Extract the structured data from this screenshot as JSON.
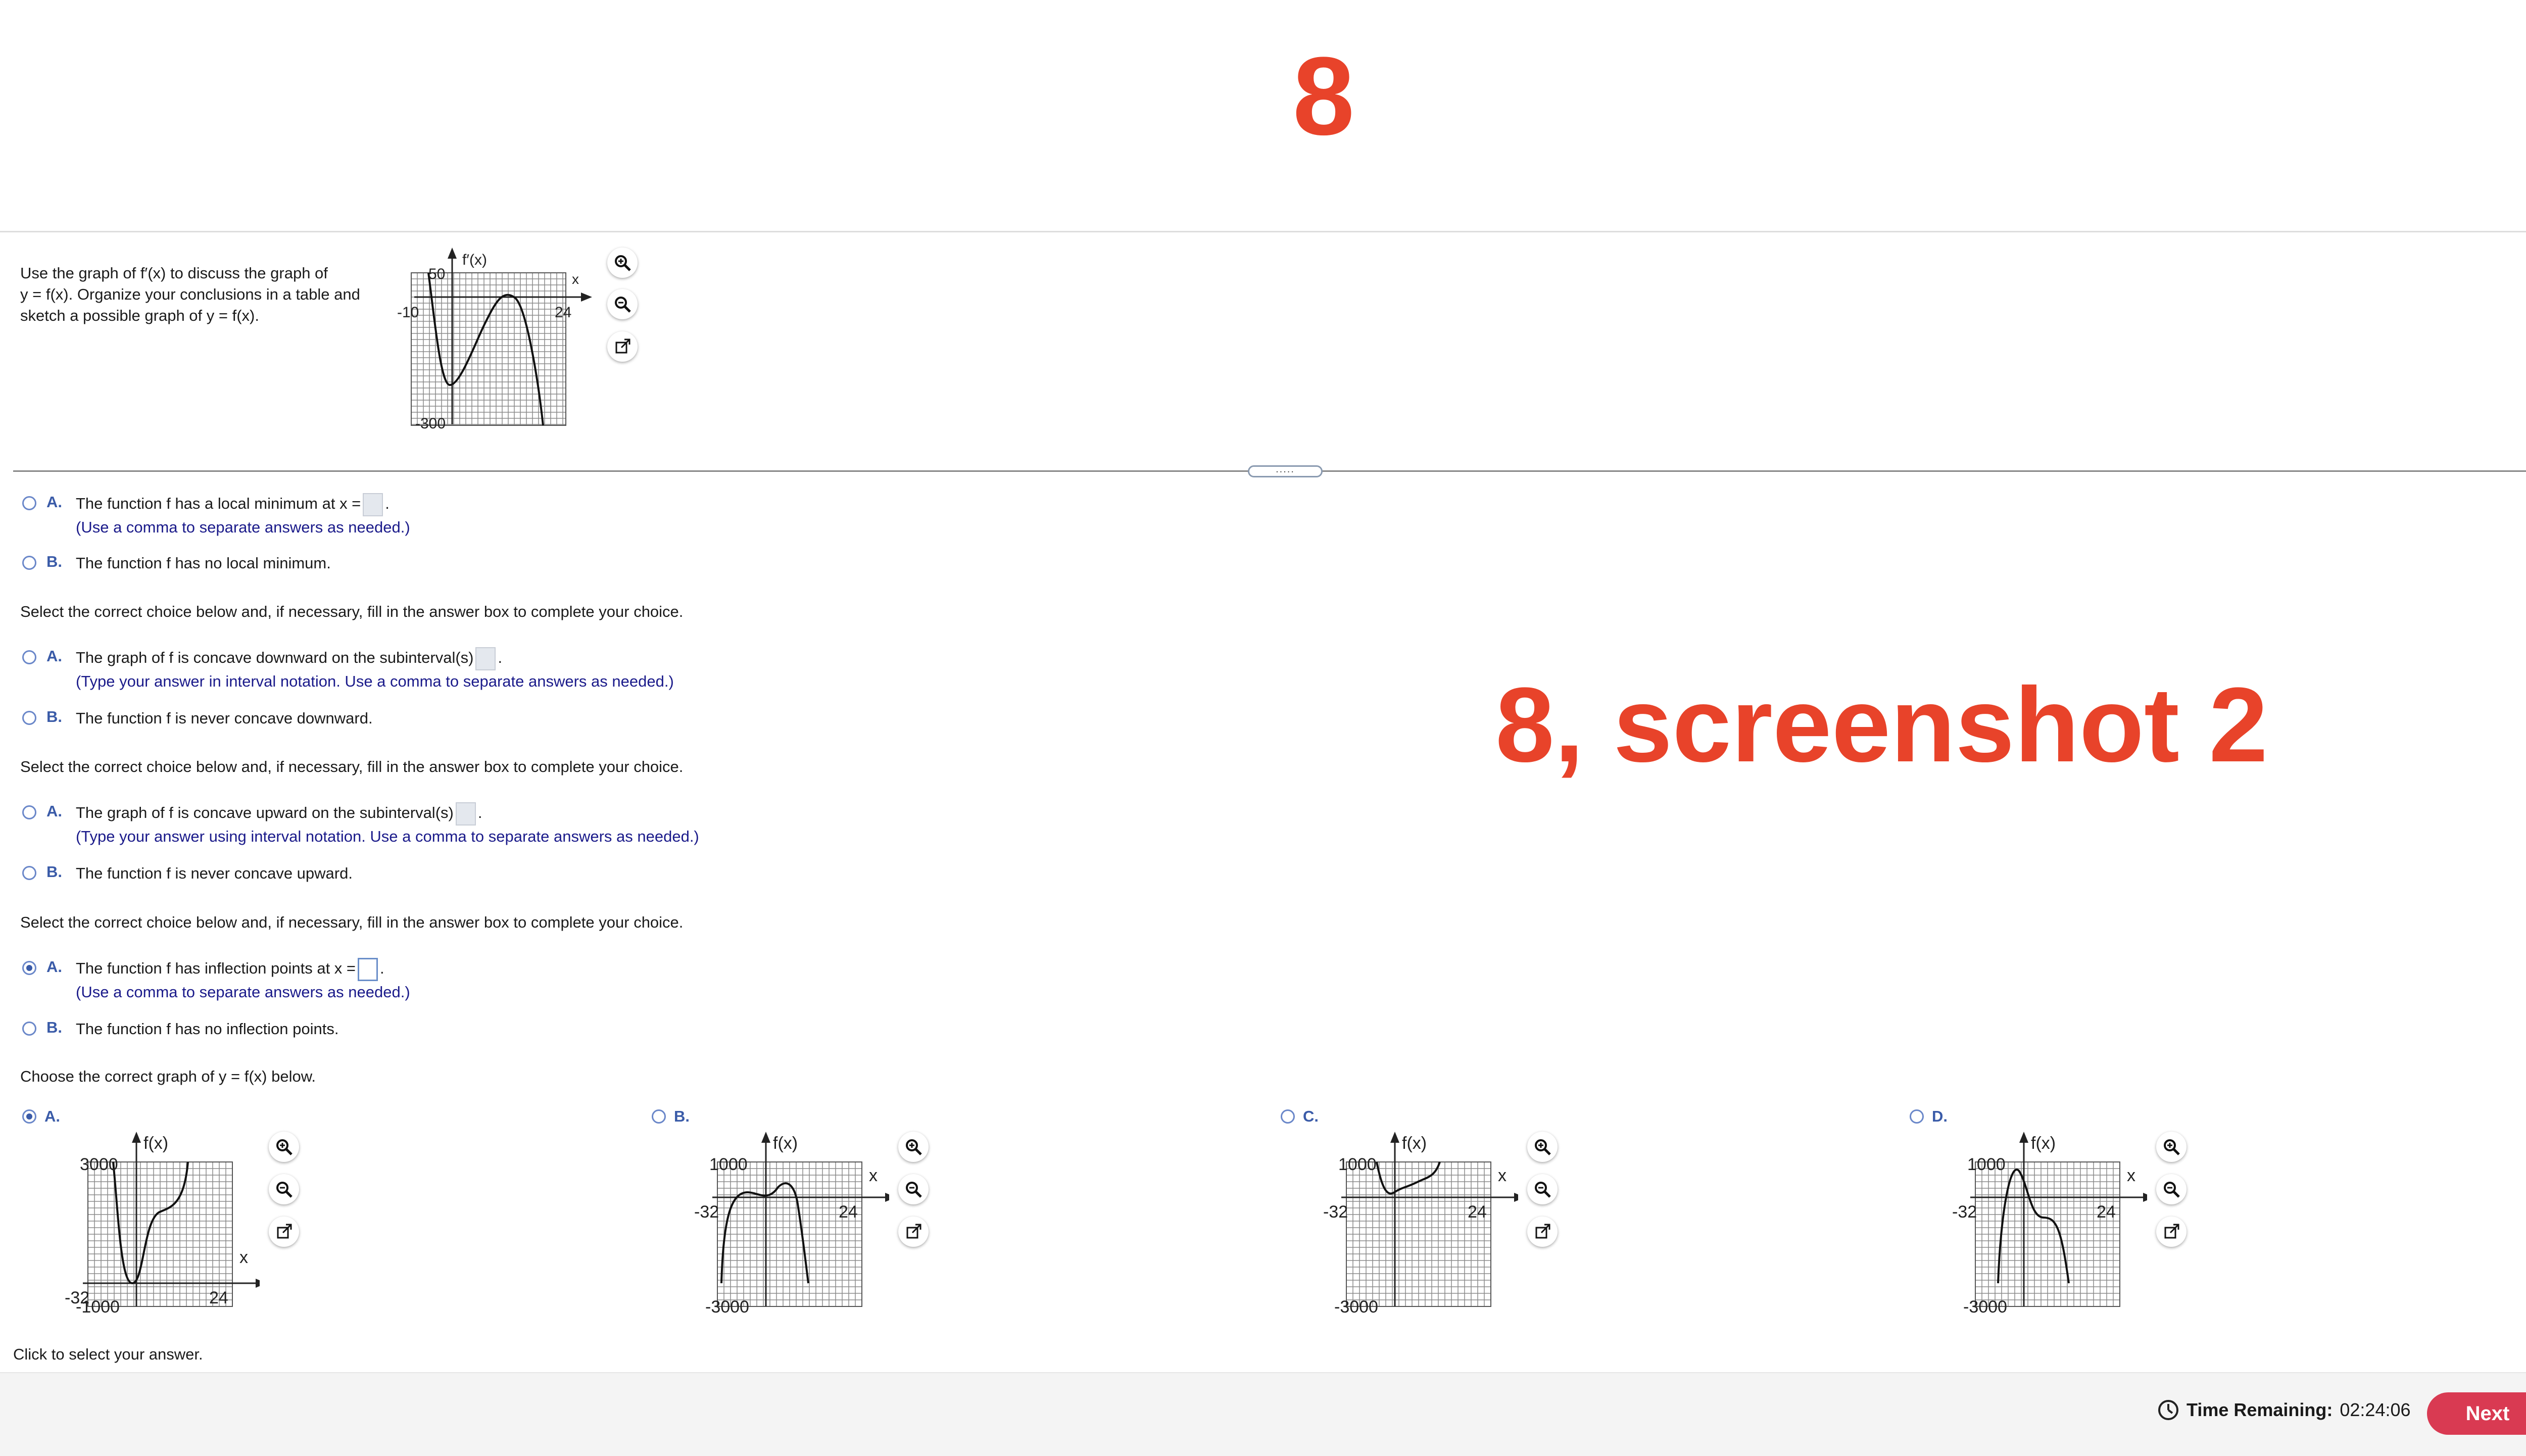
{
  "banner": {
    "number": "8",
    "caption": "8, screenshot 2"
  },
  "question": {
    "prompt": [
      "Use the graph of f′(x) to discuss the graph of",
      "y = f(x). Organize your conclusions in a table and",
      "sketch a possible graph of y = f(x)."
    ],
    "graph": {
      "ylabel": "f′(x)",
      "xlabel": "x",
      "xmin_label": "-10",
      "xmax_label": "24",
      "ymax_label": "50",
      "ymin_label": "-300"
    }
  },
  "splitter": {
    "label": "....."
  },
  "parts": [
    {
      "instruction": "",
      "options": [
        {
          "letter": "A.",
          "text": "The function f has a local minimum at x =",
          "hint": "(Use a comma to separate answers as needed.)",
          "selected": false,
          "has_box": true
        },
        {
          "letter": "B.",
          "text": "The function f has no local minimum.",
          "selected": false
        }
      ]
    },
    {
      "instruction": "Select the correct choice below and, if necessary, fill in the answer box to complete your choice.",
      "options": [
        {
          "letter": "A.",
          "text": "The graph of f is concave downward on the subinterval(s)",
          "hint": "(Type your answer in interval notation. Use a comma to separate answers as needed.)",
          "selected": false,
          "has_box": true
        },
        {
          "letter": "B.",
          "text": "The function f is never concave downward.",
          "selected": false
        }
      ]
    },
    {
      "instruction": "Select the correct choice below and, if necessary, fill in the answer box to complete your choice.",
      "options": [
        {
          "letter": "A.",
          "text": "The graph of f is concave upward on the subinterval(s)",
          "hint": "(Type your answer using interval notation. Use a comma to separate answers as needed.)",
          "selected": false,
          "has_box": true
        },
        {
          "letter": "B.",
          "text": "The function f is never concave upward.",
          "selected": false
        }
      ]
    },
    {
      "instruction": "Select the correct choice below and, if necessary, fill in the answer box to complete your choice.",
      "options": [
        {
          "letter": "A.",
          "text": "The function f has inflection points at x =",
          "hint": "(Use a comma to separate answers as needed.)",
          "selected": true,
          "has_box": true
        },
        {
          "letter": "B.",
          "text": "The function f has no inflection points.",
          "selected": false
        }
      ]
    }
  ],
  "graph_choice": {
    "instruction": "Choose the correct graph of y = f(x) below.",
    "options": [
      {
        "letter": "A.",
        "selected": true,
        "ylabel": "f(x)",
        "xlabel": "x",
        "xmin": "-32",
        "xmax": "24",
        "ytop": "3000",
        "ybottom": "-1000"
      },
      {
        "letter": "B.",
        "selected": false,
        "ylabel": "f(x)",
        "xlabel": "x",
        "xmin": "-32",
        "xmax": "24",
        "ytop": "1000",
        "ybottom": "-3000"
      },
      {
        "letter": "C.",
        "selected": false,
        "ylabel": "f(x)",
        "xlabel": "x",
        "xmin": "-32",
        "xmax": "24",
        "ytop": "1000",
        "ybottom": "-3000"
      },
      {
        "letter": "D.",
        "selected": false,
        "ylabel": "f(x)",
        "xlabel": "x",
        "xmin": "-32",
        "xmax": "24",
        "ytop": "1000",
        "ybottom": "-3000"
      }
    ]
  },
  "status": {
    "click_hint": "Click to select your answer."
  },
  "footer": {
    "timer_label": "Time Remaining:",
    "timer_value": "02:24:06",
    "next_label": "Next"
  },
  "colors": {
    "accent": "#3a5ba8",
    "next": "#d93a52",
    "banner": "#e8432a"
  },
  "icons": [
    "zoom-in-icon",
    "zoom-out-icon",
    "pop-out-icon",
    "clock-icon"
  ]
}
